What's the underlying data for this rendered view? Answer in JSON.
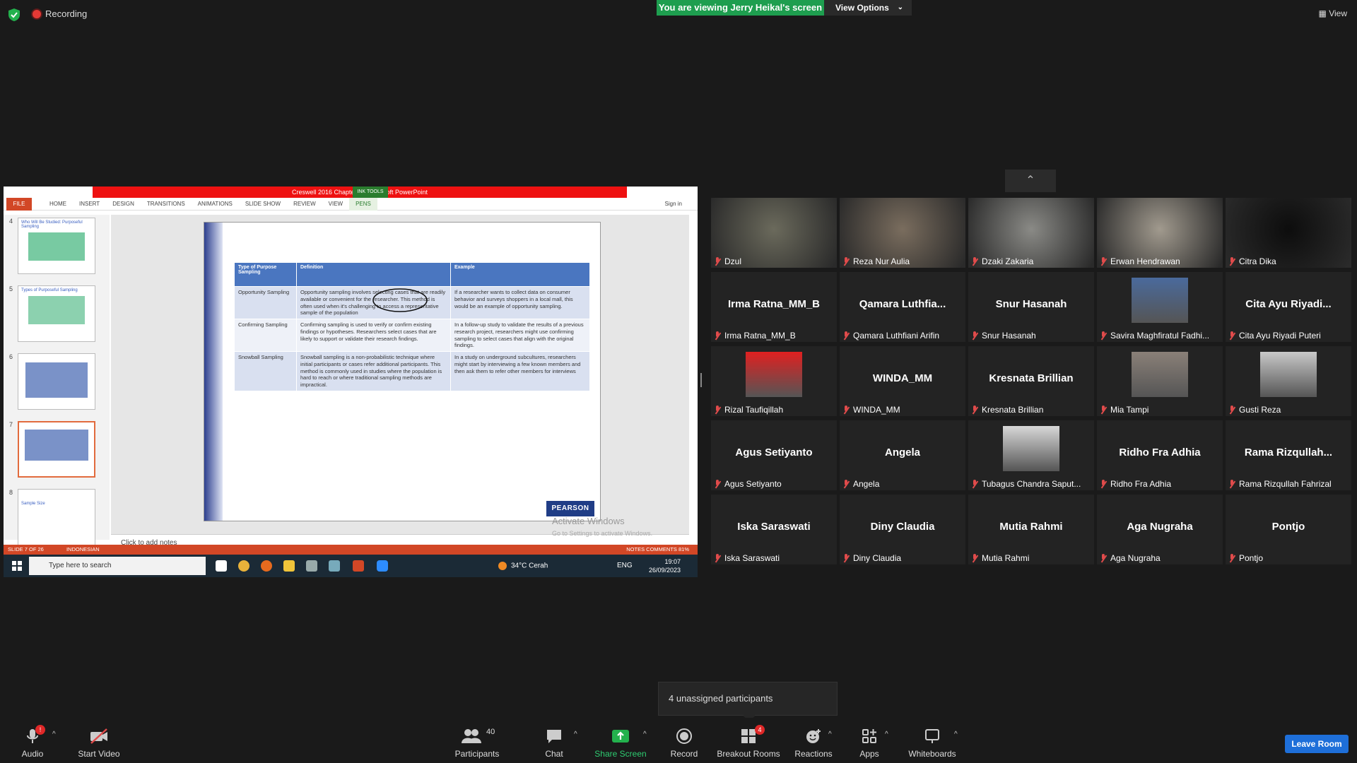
{
  "topbar": {
    "recording": "Recording",
    "viewing_banner": "You are viewing Jerry Heikal's screen",
    "view_options": "View Options",
    "view": "View"
  },
  "shared_screen": {
    "window_title": "Creswell 2016 Chapter 7 - Microsoft PowerPoint",
    "ink_tools": "INK TOOLS",
    "ribbon_file": "FILE",
    "ribbon_tabs": [
      "HOME",
      "INSERT",
      "DESIGN",
      "TRANSITIONS",
      "ANIMATIONS",
      "SLIDE SHOW",
      "REVIEW",
      "VIEW",
      "PENS"
    ],
    "sign_in": "Sign in",
    "thumbnails": [
      {
        "num": "4",
        "title": "Who Will Be Studied: Purposeful Sampling"
      },
      {
        "num": "5",
        "title": "Types of Purposeful Sampling"
      },
      {
        "num": "6",
        "title": ""
      },
      {
        "num": "7",
        "title": ""
      },
      {
        "num": "8",
        "title": "Sample Size"
      }
    ],
    "table": {
      "headers": [
        "Type of Purpose Sampling",
        "Definition",
        "Example"
      ],
      "rows": [
        [
          "Opportunity Sampling",
          "Opportunity sampling involves selecting cases that are readily available or convenient for the researcher. This method is often used when it's challenging to access a representative sample of the population",
          "If a researcher wants to collect data on consumer behavior and surveys shoppers in a local mall, this would be an example of opportunity sampling."
        ],
        [
          "Confirming Sampling",
          "Confirming sampling is used to verify or confirm existing findings or hypotheses. Researchers select cases that are likely to support or validate their research findings.",
          "In a follow-up study to validate the results of a previous research project, researchers might use confirming sampling to select cases that align with the original findings."
        ],
        [
          "Snowball Sampling",
          "Snowball sampling is a non-probabilistic technique where initial participants or cases refer additional participants. This method is commonly used in studies where the population is hard to reach or where traditional sampling methods are impractical.",
          "In a study on underground subcultures, researchers might start by interviewing a few known members and then ask them to refer other members for interviews"
        ]
      ]
    },
    "logo": "PEARSON",
    "notes": "Click to add notes",
    "activate_title": "Activate Windows",
    "activate_sub": "Go to Settings to activate Windows.",
    "status_left": "SLIDE 7 OF 26",
    "status_lang": "INDONESIAN",
    "status_right": "NOTES    COMMENTS                                          81%",
    "taskbar_search": "Type here to search",
    "weather": "34°C  Cerah",
    "lang": "ENG",
    "time": "19:07",
    "date": "26/09/2023"
  },
  "gallery": [
    {
      "label": "Dzul",
      "center": "",
      "kind": "video",
      "tone": "#6b6a5c"
    },
    {
      "label": "Reza Nur Aulia",
      "center": "",
      "kind": "video",
      "tone": "#7a6d5e"
    },
    {
      "label": "Dzaki Zakaria",
      "center": "",
      "kind": "video",
      "tone": "#8a8a86"
    },
    {
      "label": "Erwan Hendrawan",
      "center": "",
      "kind": "video",
      "tone": "#a19a8e"
    },
    {
      "label": "Citra Dika",
      "center": "",
      "kind": "video",
      "tone": "#0d0d0d"
    },
    {
      "label": "Irma Ratna_MM_B",
      "center": "Irma Ratna_MM_B",
      "kind": "name"
    },
    {
      "label": "Qamara Luthfiani Arifin",
      "center": "Qamara  Luthfia...",
      "kind": "name"
    },
    {
      "label": "Snur Hasanah",
      "center": "Snur Hasanah",
      "kind": "name"
    },
    {
      "label": "Savira Maghfiratul Fadhi...",
      "center": "",
      "kind": "pic",
      "tone": "#4a6a9c"
    },
    {
      "label": "Cita Ayu Riyadi Puteri",
      "center": "Cita  Ayu  Riyadi...",
      "kind": "name"
    },
    {
      "label": "Rizal Taufiqillah",
      "center": "",
      "kind": "pic",
      "tone": "#e02020"
    },
    {
      "label": "WINDA_MM",
      "center": "WINDA_MM",
      "kind": "name"
    },
    {
      "label": "Kresnata Brillian",
      "center": "Kresnata Brillian",
      "kind": "name"
    },
    {
      "label": "Mia Tampi",
      "center": "",
      "kind": "pic",
      "tone": "#8a8078"
    },
    {
      "label": "Gusti Reza",
      "center": "",
      "kind": "pic",
      "tone": "#c8c8c8"
    },
    {
      "label": "Agus Setiyanto",
      "center": "Agus Setiyanto",
      "kind": "name"
    },
    {
      "label": "Angela",
      "center": "Angela",
      "kind": "name"
    },
    {
      "label": "Tubagus Chandra Saput...",
      "center": "",
      "kind": "pic",
      "tone": "#d8d8d8"
    },
    {
      "label": "Ridho Fra Adhia",
      "center": "Ridho Fra Adhia",
      "kind": "name"
    },
    {
      "label": "Rama Rizqullah Fahrizal",
      "center": "Rama  Rizqullah...",
      "kind": "name"
    },
    {
      "label": "Iska Saraswati",
      "center": "Iska Saraswati",
      "kind": "name"
    },
    {
      "label": "Diny Claudia",
      "center": "Diny Claudia",
      "kind": "name"
    },
    {
      "label": "Mutia Rahmi",
      "center": "Mutia Rahmi",
      "kind": "name"
    },
    {
      "label": "Aga Nugraha",
      "center": "Aga Nugraha",
      "kind": "name"
    },
    {
      "label": "Pontjo",
      "center": "Pontjo",
      "kind": "name"
    }
  ],
  "unassigned": "4 unassigned participants",
  "toolbar": {
    "audio": "Audio",
    "audio_badge": "!",
    "start_video": "Start Video",
    "participants": "Participants",
    "participants_count": "40",
    "chat": "Chat",
    "share_screen": "Share Screen",
    "record": "Record",
    "breakout_rooms": "Breakout Rooms",
    "breakout_badge": "4",
    "reactions": "Reactions",
    "apps": "Apps",
    "whiteboards": "Whiteboards",
    "leave": "Leave Room"
  },
  "colors": {
    "share_green": "#1e9e4f",
    "leave_blue": "#1e6fd9",
    "ppt_red": "#d24726"
  }
}
